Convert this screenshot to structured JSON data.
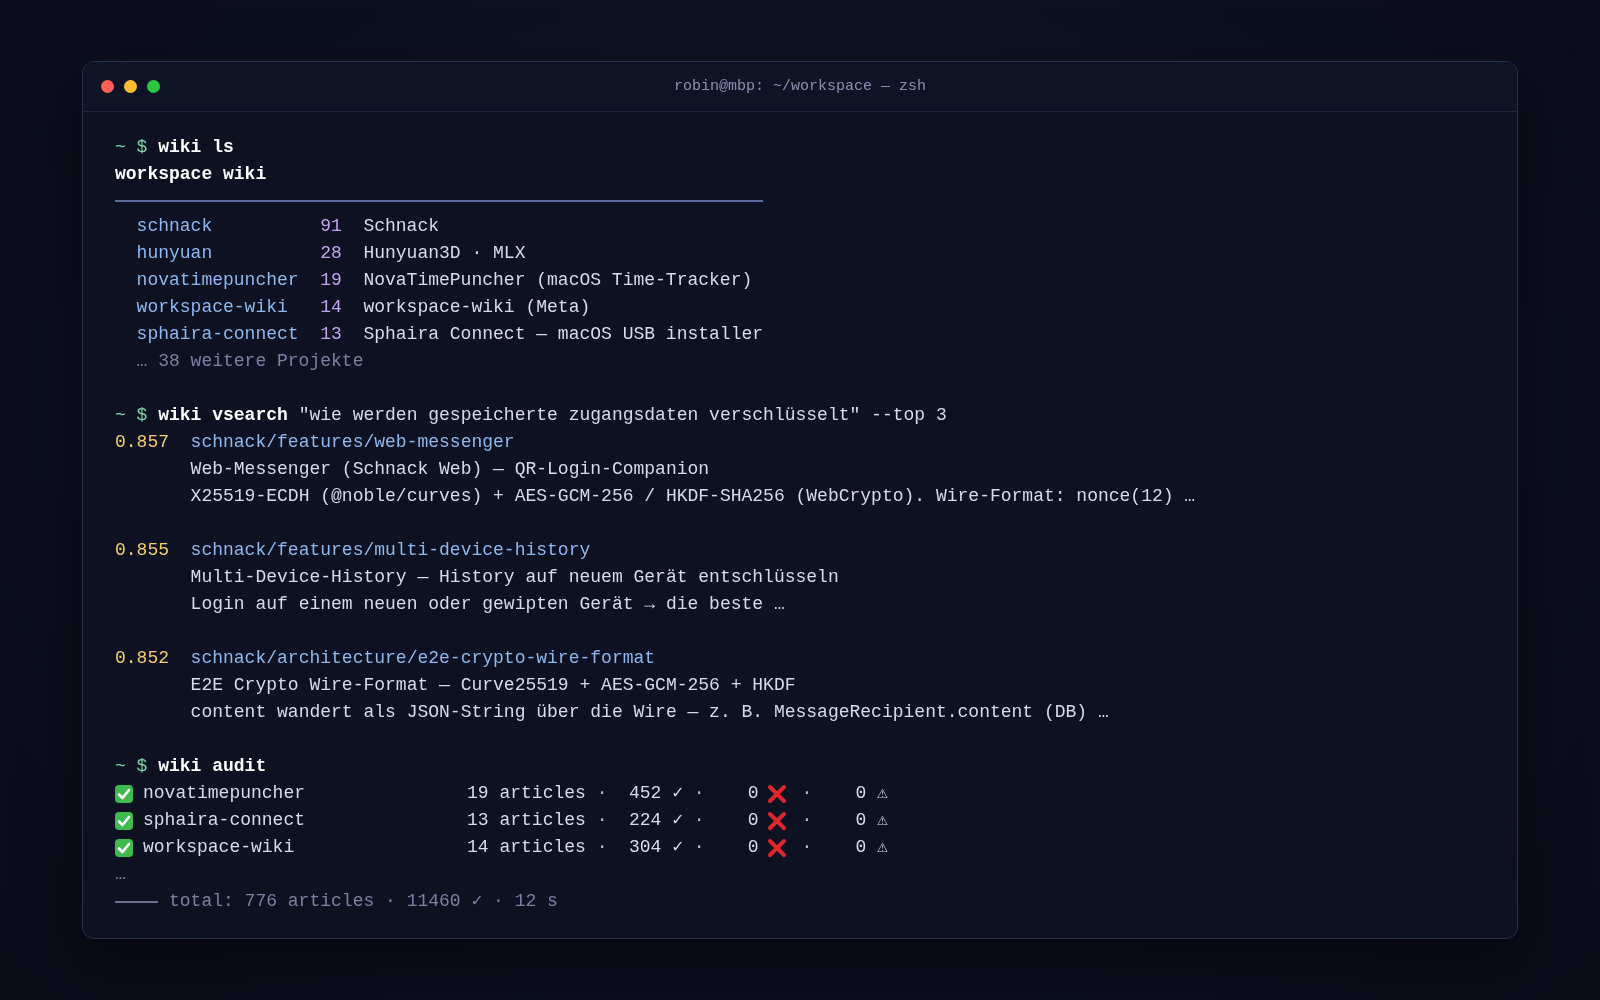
{
  "window": {
    "title": "robin@mbp: ~/workspace — zsh"
  },
  "blocks": [
    {
      "kind": "ls",
      "prompt": "~ $",
      "command": "wiki ls",
      "heading": "workspace wiki",
      "rows": [
        {
          "slug": "schnack",
          "count": "91",
          "title": "Schnack"
        },
        {
          "slug": "hunyuan",
          "count": "28",
          "title": "Hunyuan3D · MLX"
        },
        {
          "slug": "novatimepuncher",
          "count": "19",
          "title": "NovaTimePuncher (macOS Time-Tracker)"
        },
        {
          "slug": "workspace-wiki",
          "count": "14",
          "title": "workspace-wiki (Meta)"
        },
        {
          "slug": "sphaira-connect",
          "count": "13",
          "title": "Sphaira Connect — macOS USB installer"
        }
      ],
      "more": "… 38 weitere Projekte"
    },
    {
      "kind": "vsearch",
      "prompt": "~ $",
      "command": "wiki vsearch",
      "args": "\"wie werden gespeicherte zugangsdaten verschlüsselt\" --top 3",
      "results": [
        {
          "score": "0.857",
          "path": "schnack/features/web-messenger",
          "title": "Web-Messenger (Schnack Web) — QR-Login-Companion",
          "snippet": "X25519-ECDH (@noble/curves) + AES-GCM-256 / HKDF-SHA256 (WebCrypto). Wire-Format: nonce(12) …"
        },
        {
          "score": "0.855",
          "path": "schnack/features/multi-device-history",
          "title": "Multi-Device-History — History auf neuem Gerät entschlüsseln",
          "snippet": "Login auf einem neuen oder gewipten Gerät → die beste …"
        },
        {
          "score": "0.852",
          "path": "schnack/architecture/e2e-crypto-wire-format",
          "title": "E2E Crypto Wire-Format — Curve25519 + AES-GCM-256 + HKDF",
          "snippet": "content wandert als JSON-String über die Wire — z. B. MessageRecipient.content (DB) …"
        }
      ]
    },
    {
      "kind": "audit",
      "prompt": "~ $",
      "command": "wiki audit",
      "rows": [
        {
          "ok": true,
          "name": "novatimepuncher",
          "articles": "19 articles",
          "sep_1": "·",
          "checks": "452 ✓",
          "sep_2": "·",
          "errors": "0",
          "sep_3": "·",
          "warnings": "0 ⚠"
        },
        {
          "ok": true,
          "name": "sphaira-connect",
          "articles": "13 articles",
          "sep_1": "·",
          "checks": "224 ✓",
          "sep_2": "·",
          "errors": "0",
          "sep_3": "·",
          "warnings": "0 ⚠"
        },
        {
          "ok": true,
          "name": "workspace-wiki",
          "articles": "14 articles",
          "sep_1": "·",
          "checks": "304 ✓",
          "sep_2": "·",
          "errors": "0",
          "sep_3": "·",
          "warnings": "0 ⚠"
        }
      ],
      "ellipsis": "…",
      "total": "total: 776 articles · 11460 ✓ · 12 s"
    }
  ]
}
